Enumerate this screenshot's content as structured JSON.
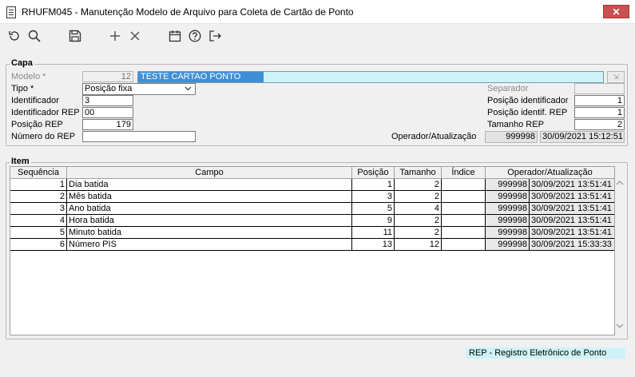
{
  "window": {
    "title": "RHUFM045 - Manutenção Modelo de Arquivo para Coleta de Cartão de Ponto",
    "close_label": "✕"
  },
  "toolbar": {
    "icons": [
      "refresh-icon",
      "search-icon",
      "save-icon",
      "add-icon",
      "delete-icon",
      "calendar-icon",
      "help-icon",
      "exit-icon"
    ]
  },
  "capa": {
    "title": "Capa",
    "modelo_label": "Modelo *",
    "modelo_value": "12",
    "modelo_desc": "TESTE CARTAO PONTO",
    "tipo_label": "Tipo *",
    "tipo_value": "Posição fixa",
    "identificador_label": "Identificador",
    "identificador_value": "3",
    "identificador_rep_label": "Identificador REP",
    "identificador_rep_value": "00",
    "posicao_rep_label": "Posição REP",
    "posicao_rep_value": "179",
    "numero_rep_label": "Número do REP",
    "numero_rep_value": "",
    "separador_label": "Separador",
    "separador_value": "",
    "posicao_identificador_label": "Posição identificador",
    "posicao_identificador_value": "1",
    "posicao_identif_rep_label": "Posição identif. REP",
    "posicao_identif_rep_value": "1",
    "tamanho_rep_label": "Tamanho REP",
    "tamanho_rep_value": "2",
    "operador_label": "Operador/Atualização",
    "operador_value": "999998",
    "atualizacao_value": "30/09/2021 15:12:51"
  },
  "item": {
    "title": "Item",
    "columns": [
      "Sequência",
      "Campo",
      "Posição",
      "Tamanho",
      "Índice",
      "Operador/Atualização"
    ],
    "rows": [
      {
        "seq": "1",
        "campo": "Dia batida",
        "posicao": "1",
        "tamanho": "2",
        "indice": "",
        "operador": "999998",
        "data": "30/09/2021 13:51:41"
      },
      {
        "seq": "2",
        "campo": "Mês batida",
        "posicao": "3",
        "tamanho": "2",
        "indice": "",
        "operador": "999998",
        "data": "30/09/2021 13:51:41"
      },
      {
        "seq": "3",
        "campo": "Ano batida",
        "posicao": "5",
        "tamanho": "4",
        "indice": "",
        "operador": "999998",
        "data": "30/09/2021 13:51:41"
      },
      {
        "seq": "4",
        "campo": "Hora batida",
        "posicao": "9",
        "tamanho": "2",
        "indice": "",
        "operador": "999998",
        "data": "30/09/2021 13:51:41"
      },
      {
        "seq": "5",
        "campo": "Minuto batida",
        "posicao": "11",
        "tamanho": "2",
        "indice": "",
        "operador": "999998",
        "data": "30/09/2021 13:51:41"
      },
      {
        "seq": "6",
        "campo": "Número PIS",
        "posicao": "13",
        "tamanho": "12",
        "indice": "",
        "operador": "999998",
        "data": "30/09/2021 15:33:33"
      }
    ]
  },
  "status": {
    "hint": "REP - Registro Eletrônico de Ponto"
  }
}
